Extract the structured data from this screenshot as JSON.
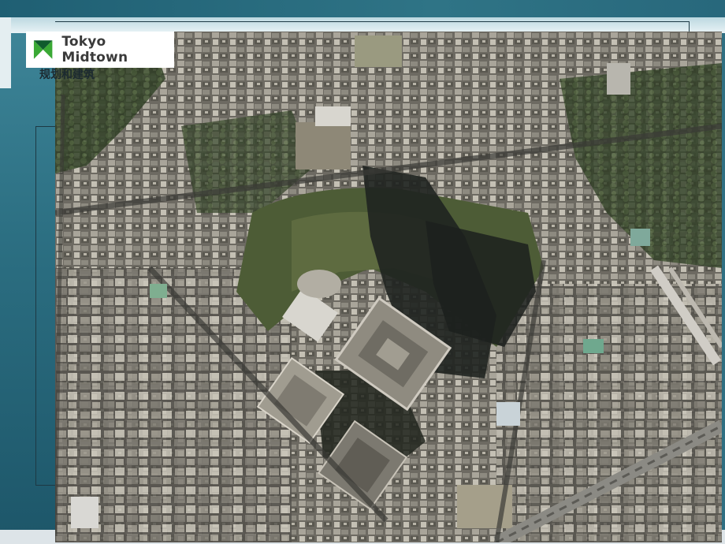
{
  "slide": {
    "logo_text": "Tokyo Midtown",
    "subtitle": "规划和建筑"
  },
  "photo": {
    "kind": "aerial-satellite-photo",
    "subject": "Tokyo Midtown aerial view"
  },
  "colors": {
    "frame": "#2f6f82",
    "logo_green": "#3aa935",
    "logo_dark_green": "#0f5a2d"
  },
  "icons": [
    "tokyo-midtown-logo-icon"
  ]
}
